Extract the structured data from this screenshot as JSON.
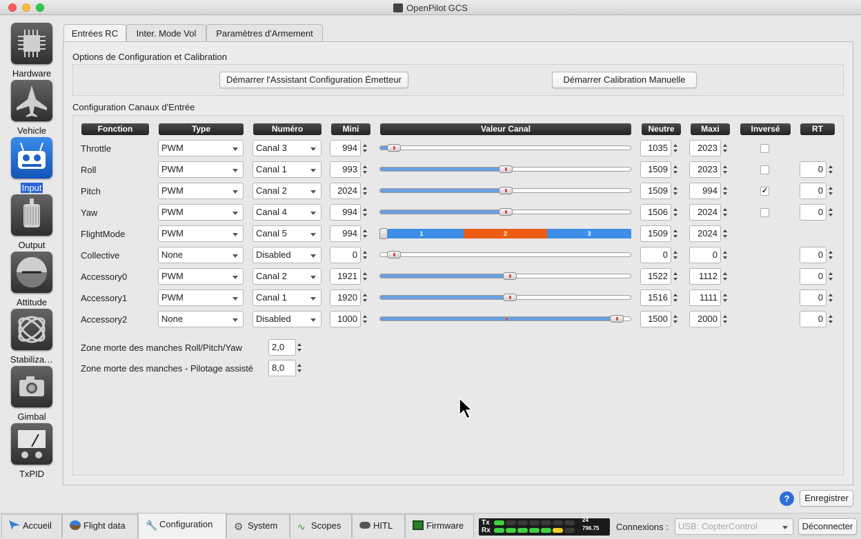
{
  "window": {
    "title": "OpenPilot GCS"
  },
  "sidebar": [
    {
      "label": "Hardware",
      "icon": "chip-icon"
    },
    {
      "label": "Vehicle",
      "icon": "aircraft-icon"
    },
    {
      "label": "Input",
      "icon": "transmitter-icon"
    },
    {
      "label": "Output",
      "icon": "motor-icon"
    },
    {
      "label": "Attitude",
      "icon": "horizon-icon"
    },
    {
      "label": "Stabiliza…",
      "icon": "gyroscope-icon"
    },
    {
      "label": "Gimbal",
      "icon": "camera-icon"
    },
    {
      "label": "TxPID",
      "icon": "gauge-icon"
    }
  ],
  "tabs": [
    "Entrées RC",
    "Inter. Mode Vol",
    "Paramètres d'Armement"
  ],
  "calibration": {
    "title": "Options de Configuration et Calibration",
    "wizard_button": "Démarrer l'Assistant Configuration Émetteur",
    "manual_button": "Démarrer Calibration Manuelle"
  },
  "channels": {
    "title": "Configuration Canaux d'Entrée",
    "headers": {
      "fonction": "Fonction",
      "type": "Type",
      "numero": "Numéro",
      "mini": "Mini",
      "valeur": "Valeur Canal",
      "neutre": "Neutre",
      "maxi": "Maxi",
      "inverse": "Inversé",
      "rt": "RT"
    },
    "rows": [
      {
        "fonction": "Throttle",
        "type": "PWM",
        "numero": "Canal 3",
        "mini": "994",
        "neutre": "1035",
        "maxi": "2023",
        "inverse": false,
        "rt": null,
        "value_fraction": 0.03
      },
      {
        "fonction": "Roll",
        "type": "PWM",
        "numero": "Canal 1",
        "mini": "993",
        "neutre": "1509",
        "maxi": "2023",
        "inverse": false,
        "rt": "0",
        "value_fraction": 0.5
      },
      {
        "fonction": "Pitch",
        "type": "PWM",
        "numero": "Canal 2",
        "mini": "2024",
        "neutre": "1509",
        "maxi": "994",
        "inverse": true,
        "rt": "0",
        "value_fraction": 0.5
      },
      {
        "fonction": "Yaw",
        "type": "PWM",
        "numero": "Canal 4",
        "mini": "994",
        "neutre": "1506",
        "maxi": "2024",
        "inverse": false,
        "rt": "0",
        "value_fraction": 0.5
      },
      {
        "fonction": "FlightMode",
        "type": "PWM",
        "numero": "Canal 5",
        "mini": "994",
        "neutre": "1509",
        "maxi": "2024",
        "inverse": null,
        "rt": null,
        "value_fraction": 0
      },
      {
        "fonction": "Collective",
        "type": "None",
        "numero": "Disabled",
        "mini": "0",
        "neutre": "0",
        "maxi": "0",
        "inverse": null,
        "rt": "0",
        "value_fraction": 0.03
      },
      {
        "fonction": "Accessory0",
        "type": "PWM",
        "numero": "Canal 2",
        "mini": "1921",
        "neutre": "1522",
        "maxi": "1112",
        "inverse": null,
        "rt": "0",
        "value_fraction": 0.52
      },
      {
        "fonction": "Accessory1",
        "type": "PWM",
        "numero": "Canal 1",
        "mini": "1920",
        "neutre": "1516",
        "maxi": "1111",
        "inverse": null,
        "rt": "0",
        "value_fraction": 0.52
      },
      {
        "fonction": "Accessory2",
        "type": "None",
        "numero": "Disabled",
        "mini": "1000",
        "neutre": "1500",
        "maxi": "2000",
        "inverse": null,
        "rt": "0",
        "value_fraction": 0.97
      }
    ],
    "flightmode_positions": [
      "1",
      "2",
      "3"
    ],
    "flightmode_colors": [
      "#3d8ee6",
      "#ec5c12",
      "#3d8ee6"
    ]
  },
  "deadband": {
    "rollpitchyaw_label": "Zone morte des manches Roll/Pitch/Yaw",
    "rollpitchyaw_value": "2,0",
    "assisted_label": "Zone morte des manches - Pilotage assisté",
    "assisted_value": "8,0"
  },
  "save_button": "Enregistrer",
  "bottom_tabs": [
    "Accueil",
    "Flight data",
    "Configuration",
    "System",
    "Scopes",
    "HITL",
    "Firmware"
  ],
  "telemetry": {
    "tx_label": "Tx",
    "rx_label": "Rx",
    "value_top": "24",
    "value_bottom": "796.75"
  },
  "connection": {
    "label": "Connexions :",
    "device": "USB: CopterControl",
    "disconnect": "Déconnecter"
  },
  "colors": {
    "accent": "#2a63d6",
    "slider_fill": "#6b9fe0"
  }
}
